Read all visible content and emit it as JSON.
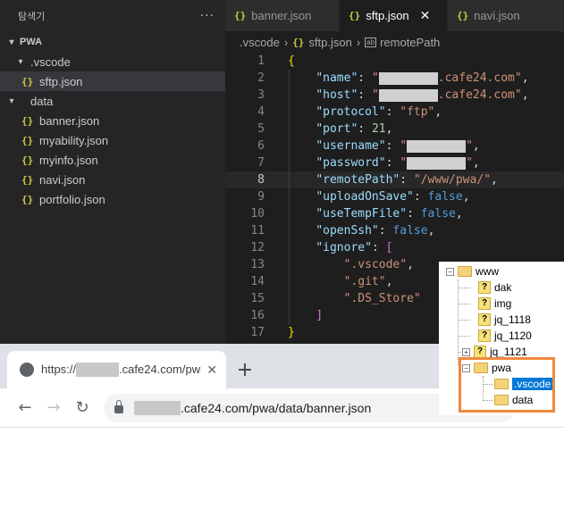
{
  "explorer": {
    "title": "탐색기",
    "more": "···",
    "root": "PWA",
    "items": [
      {
        "label": ".vscode",
        "type": "folder",
        "indent": 1
      },
      {
        "label": "sftp.json",
        "type": "json",
        "indent": 2
      },
      {
        "label": "data",
        "type": "folder",
        "indent": 1
      },
      {
        "label": "banner.json",
        "type": "json",
        "indent": 2
      },
      {
        "label": "myability.json",
        "type": "json",
        "indent": 2
      },
      {
        "label": "myinfo.json",
        "type": "json",
        "indent": 2
      },
      {
        "label": "navi.json",
        "type": "json",
        "indent": 2
      },
      {
        "label": "portfolio.json",
        "type": "json",
        "indent": 2
      }
    ]
  },
  "json_icon": "{}",
  "tabs": [
    {
      "label": "banner.json"
    },
    {
      "label": "sftp.json",
      "active": true
    },
    {
      "label": "navi.json"
    }
  ],
  "breadcrumb": {
    "folder": ".vscode",
    "file": "sftp.json",
    "symbol": "remotePath",
    "symbol_icon": "ab"
  },
  "code": {
    "line_numbers": [
      "1",
      "2",
      "3",
      "4",
      "5",
      "6",
      "7",
      "8",
      "9",
      "10",
      "11",
      "12",
      "13",
      "14",
      "15",
      "16",
      "17"
    ],
    "current_line": 8,
    "name_key": "\"name\"",
    "name_suffix": ".cafe24.com\"",
    "host_key": "\"host\"",
    "host_suffix": ".cafe24.com\"",
    "protocol_key": "\"protocol\"",
    "protocol_val": "\"ftp\"",
    "port_key": "\"port\"",
    "port_val": "21",
    "username_key": "\"username\"",
    "password_key": "\"password\"",
    "remote_key": "\"remotePath\"",
    "remote_val": "\"/www/pwa/\"",
    "upload_key": "\"uploadOnSave\"",
    "upload_val": "false",
    "temp_key": "\"useTempFile\"",
    "temp_val": "false",
    "ssh_key": "\"openSsh\"",
    "ssh_val": "false",
    "ignore_key": "\"ignore\"",
    "ignore_items": [
      "\".vscode\"",
      "\".git\"",
      "\".DS_Store\""
    ]
  },
  "browser": {
    "tab_prefix": "https://",
    "tab_suffix": ".cafe24.com/pwa",
    "new_tab": "+",
    "url_suffix": ".cafe24.com/pwa/data/banner.json"
  },
  "ftp_tree": {
    "items": [
      "www",
      "dak",
      "img",
      "jq_1118",
      "jq_1120",
      "jq_1121",
      "pwa",
      ".vscode",
      "data"
    ]
  },
  "colors": {
    "highlight": "#f0883e",
    "selection": "#0078d7",
    "json_icon": "#cbcb41"
  }
}
